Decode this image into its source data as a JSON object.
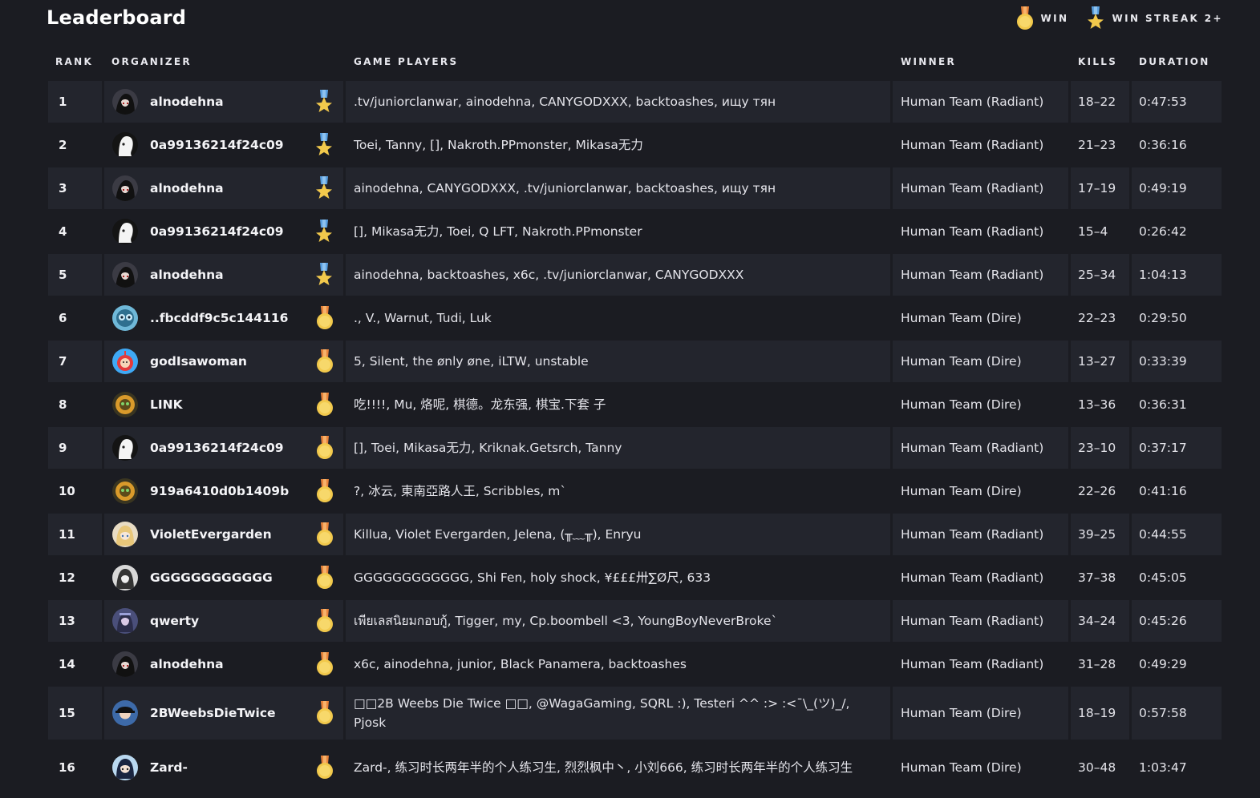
{
  "title": "Leaderboard",
  "legend": {
    "win_label": "WIN",
    "streak_label": "WIN STREAK 2+"
  },
  "columns": {
    "rank": "RANK",
    "organizer": "ORGANIZER",
    "players": "GAME PLAYERS",
    "winner": "WINNER",
    "kills": "KILLS",
    "duration": "DURATION"
  },
  "colors": {
    "background": "#1b1c22",
    "row_alt": "#23252d",
    "medal_gold": "#f2c94c",
    "medal_ribbon": "#e8833a",
    "star_ribbon": "#5aa0e0"
  },
  "rows": [
    {
      "rank": "1",
      "organizer": "alnodehna",
      "avatar": "dark-anime-avatar",
      "badge": "win-streak",
      "players": ".tv/juniorclanwar, ainodehna, CANYGODXXX, backtoashes, ищу тян",
      "winner": "Human Team (Radiant)",
      "kills": "18–22",
      "duration": "0:47:53"
    },
    {
      "rank": "2",
      "organizer": "0a99136214f24c09",
      "avatar": "white-ghost-avatar",
      "badge": "win-streak",
      "players": "Toei, Tanny, [], Nakroth.PPmonster, Mikasa无力",
      "winner": "Human Team (Radiant)",
      "kills": "21–23",
      "duration": "0:36:16"
    },
    {
      "rank": "3",
      "organizer": "alnodehna",
      "avatar": "dark-anime-avatar",
      "badge": "win-streak",
      "players": "ainodehna, CANYGODXXX, .tv/juniorclanwar, backtoashes, ищу тян",
      "winner": "Human Team (Radiant)",
      "kills": "17–19",
      "duration": "0:49:19"
    },
    {
      "rank": "4",
      "organizer": "0a99136214f24c09",
      "avatar": "white-ghost-avatar",
      "badge": "win-streak",
      "players": "[], Mikasa无力, Toei, Q LFT, Nakroth.PPmonster",
      "winner": "Human Team (Radiant)",
      "kills": "15–4",
      "duration": "0:26:42"
    },
    {
      "rank": "5",
      "organizer": "alnodehna",
      "avatar": "dark-anime-avatar",
      "badge": "win-streak",
      "players": "ainodehna, backtoashes, x6c, .tv/juniorclanwar, CANYGODXXX",
      "winner": "Human Team (Radiant)",
      "kills": "25–34",
      "duration": "1:04:13"
    },
    {
      "rank": "6",
      "organizer": "..fbcddf9c5c144116",
      "avatar": "blue-robot-avatar",
      "badge": "win",
      "players": "., V., Warnut, Tudi, Luk",
      "winner": "Human Team (Dire)",
      "kills": "22–23",
      "duration": "0:29:50"
    },
    {
      "rank": "7",
      "organizer": "godIsawoman",
      "avatar": "teletubby-avatar",
      "badge": "win",
      "players": "5, Silent, the ønly øne, iLTW, unstable",
      "winner": "Human Team (Dire)",
      "kills": "13–27",
      "duration": "0:33:39"
    },
    {
      "rank": "8",
      "organizer": "LINK",
      "avatar": "orange-robot-avatar",
      "badge": "win",
      "players": "吃!!!!, Mu, 烙呢, 棋德。龙东强, 棋宝.下套 子",
      "winner": "Human Team (Dire)",
      "kills": "13–36",
      "duration": "0:36:31"
    },
    {
      "rank": "9",
      "organizer": "0a99136214f24c09",
      "avatar": "white-ghost-avatar",
      "badge": "win",
      "players": "[], Toei, Mikasa无力, Kriknak.Getsrch, Tanny",
      "winner": "Human Team (Radiant)",
      "kills": "23–10",
      "duration": "0:37:17"
    },
    {
      "rank": "10",
      "organizer": "919a6410d0b1409b",
      "avatar": "orange-robot-avatar",
      "badge": "win",
      "players": "?, 冰云, 東南亞路人王, Scribbles, m`",
      "winner": "Human Team (Dire)",
      "kills": "22–26",
      "duration": "0:41:16"
    },
    {
      "rank": "11",
      "organizer": "VioletEvergarden",
      "avatar": "blonde-anime-avatar",
      "badge": "win",
      "players": "Killua, Violet Evergarden, Jelena, (╥﹏╥), Enryu",
      "winner": "Human Team (Radiant)",
      "kills": "39–25",
      "duration": "0:44:55"
    },
    {
      "rank": "12",
      "organizer": "GGGGGGGGGGGG",
      "avatar": "gray-anime-avatar",
      "badge": "win",
      "players": "GGGGGGGGGGGG, Shi Fen, holy shock, ¥£££卅∑Ø尺, 633",
      "winner": "Human Team (Radiant)",
      "kills": "37–38",
      "duration": "0:45:05"
    },
    {
      "rank": "13",
      "organizer": "qwerty",
      "avatar": "purple-warrior-avatar",
      "badge": "win",
      "players": "เพียเลสนิยมกอบกู้, Tigger, my, Cp.boombell <3, YoungBoyNeverBroke`",
      "winner": "Human Team (Radiant)",
      "kills": "34–24",
      "duration": "0:45:26"
    },
    {
      "rank": "14",
      "organizer": "alnodehna",
      "avatar": "dark-anime-avatar",
      "badge": "win",
      "players": "x6c, ainodehna, junior, Black Panamera, backtoashes",
      "winner": "Human Team (Radiant)",
      "kills": "31–28",
      "duration": "0:49:29"
    },
    {
      "rank": "15",
      "organizer": "2BWeebsDieTwice",
      "avatar": "cap-avatar",
      "badge": "win",
      "players": "□□2B Weebs Die Twice □□, @WagaGaming, SQRL :), Testeri ^^ :> :<¯\\_(ツ)_/, Pjosk",
      "winner": "Human Team (Dire)",
      "kills": "18–19",
      "duration": "0:57:58"
    },
    {
      "rank": "16",
      "organizer": "Zard-",
      "avatar": "blue-anime-avatar",
      "badge": "win",
      "players": "Zard-, 练习时长两年半的个人练习生, 烈烈枫中丶, 小刘666, 练习时长两年半的个人练习生",
      "winner": "Human Team (Dire)",
      "kills": "30–48",
      "duration": "1:03:47"
    }
  ]
}
